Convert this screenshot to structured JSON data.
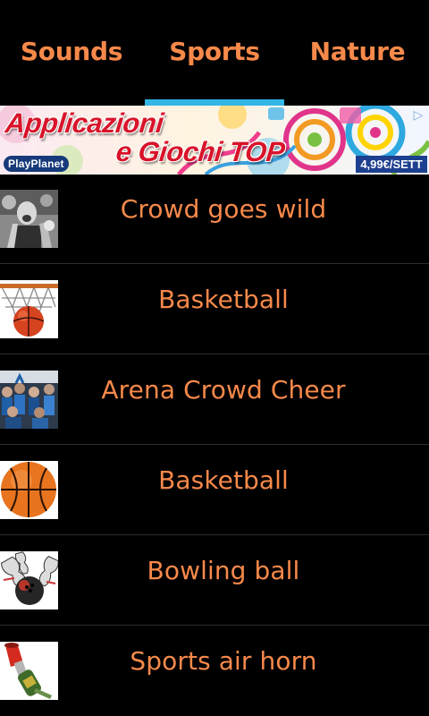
{
  "colors": {
    "accent": "#f7894a",
    "indicator": "#33b5e5",
    "background": "#000000",
    "divider": "#2c2c2c"
  },
  "tabs": [
    {
      "label": "Sounds",
      "selected": false
    },
    {
      "label": "Sports",
      "selected": true
    },
    {
      "label": "Nature",
      "selected": false
    }
  ],
  "ad": {
    "line1": "Applicazioni",
    "line2": "e Giochi TOP",
    "brand": "PlayPlanet",
    "price": "4,99€/SETT"
  },
  "items": [
    {
      "label": "Crowd goes wild",
      "icon": "cheering-crowd-photo"
    },
    {
      "label": "Basketball",
      "icon": "basketball-hoop-photo"
    },
    {
      "label": "Arena Crowd Cheer",
      "icon": "arena-crowd-photo"
    },
    {
      "label": "Basketball",
      "icon": "basketball-photo"
    },
    {
      "label": "Bowling ball",
      "icon": "bowling-pins-photo"
    },
    {
      "label": "Sports air horn",
      "icon": "air-horn-photo"
    }
  ]
}
